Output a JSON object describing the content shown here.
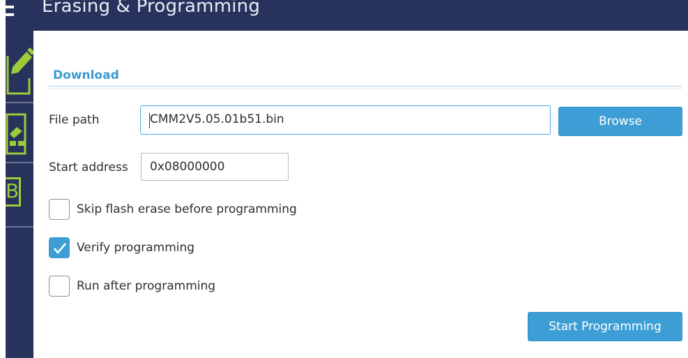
{
  "header": {
    "title": "Erasing & Programming"
  },
  "sidebar": {
    "items": [
      {
        "icon": "edit-icon"
      },
      {
        "icon": "memory-card-icon"
      },
      {
        "icon": "option-bytes-icon",
        "label": "B"
      }
    ]
  },
  "download": {
    "section_title": "Download",
    "file_path": {
      "label": "File path",
      "value": "CMM2V5.05.01b51.bin"
    },
    "browse_label": "Browse",
    "start_address": {
      "label": "Start address",
      "value": "0x08000000"
    },
    "options": [
      {
        "label": "Skip flash erase before programming",
        "checked": false
      },
      {
        "label": "Verify programming",
        "checked": true
      },
      {
        "label": "Run after programming",
        "checked": false
      }
    ],
    "start_label": "Start Programming"
  },
  "colors": {
    "navy": "#27325d",
    "accent": "#3d9ed6",
    "icon_green": "#9ccb3b"
  }
}
